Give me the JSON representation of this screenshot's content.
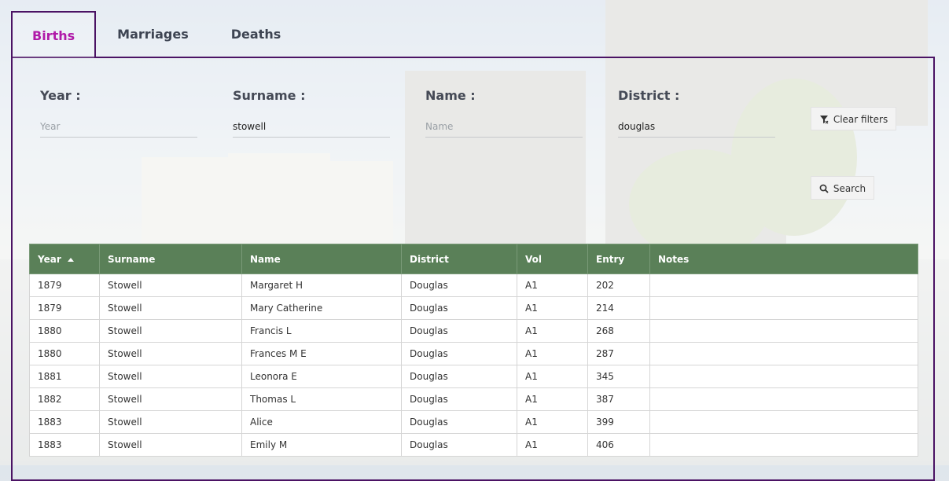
{
  "tabs": [
    {
      "label": "Births",
      "active": true
    },
    {
      "label": "Marriages",
      "active": false
    },
    {
      "label": "Deaths",
      "active": false
    }
  ],
  "filters": {
    "year": {
      "label": "Year :",
      "value": "",
      "placeholder": "Year"
    },
    "surname": {
      "label": "Surname :",
      "value": "stowell",
      "placeholder": ""
    },
    "name": {
      "label": "Name :",
      "value": "",
      "placeholder": "Name"
    },
    "district": {
      "label": "District :",
      "value": "douglas",
      "placeholder": ""
    }
  },
  "buttons": {
    "clear_filters": "Clear filters",
    "search": "Search"
  },
  "table": {
    "headers": [
      "Year",
      "Surname",
      "Name",
      "District",
      "Vol",
      "Entry",
      "Notes"
    ],
    "sorted_column": "Year",
    "sort_direction": "ascending",
    "rows": [
      [
        "1879",
        "Stowell",
        "Margaret H",
        "Douglas",
        "A1",
        "202",
        ""
      ],
      [
        "1879",
        "Stowell",
        "Mary Catherine",
        "Douglas",
        "A1",
        "214",
        ""
      ],
      [
        "1880",
        "Stowell",
        "Francis L",
        "Douglas",
        "A1",
        "268",
        ""
      ],
      [
        "1880",
        "Stowell",
        "Frances M E",
        "Douglas",
        "A1",
        "287",
        ""
      ],
      [
        "1881",
        "Stowell",
        "Leonora E",
        "Douglas",
        "A1",
        "345",
        ""
      ],
      [
        "1882",
        "Stowell",
        "Thomas L",
        "Douglas",
        "A1",
        "387",
        ""
      ],
      [
        "1883",
        "Stowell",
        "Alice",
        "Douglas",
        "A1",
        "399",
        ""
      ],
      [
        "1883",
        "Stowell",
        "Emily M",
        "Douglas",
        "A1",
        "406",
        ""
      ]
    ]
  },
  "colors": {
    "active_tab": "#b01aa8",
    "panel_border": "#4b1364",
    "table_header": "#5a8058"
  },
  "icons": {
    "clear_filters": "filter-clear-icon",
    "search": "search-icon",
    "sort": "sort-ascending-icon"
  }
}
